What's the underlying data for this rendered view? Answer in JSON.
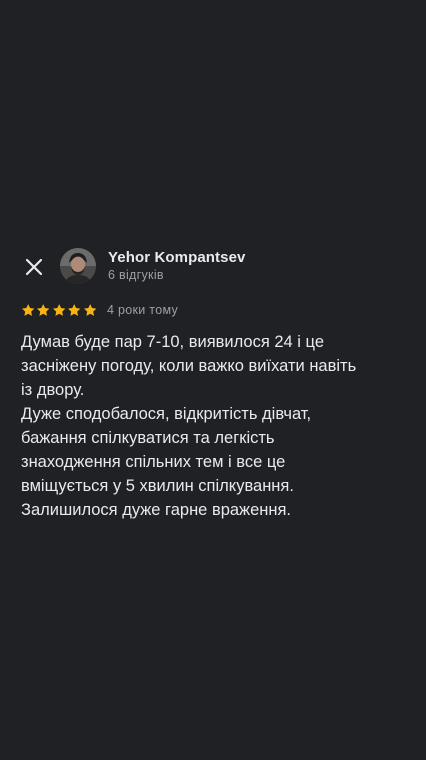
{
  "review": {
    "author_name": "Yehor Kompantsev",
    "review_count": "6 відгуків",
    "rating": 5,
    "max_rating": 5,
    "date": "4 роки тому",
    "text": "Думав буде пар 7-10, виявилося 24 і це\nзасніжену погоду, коли важко виїхати навіть\nіз двору.\nДуже сподобалося, відкритість дівчат,\nбажання спілкуватися та легкість\nзнаходження спільних тем і все це\nвміщується у 5 хвилин спілкування.\nЗалишилося дуже гарне враження."
  },
  "icons": {
    "close": "close-icon",
    "star": "star-icon",
    "avatar": "avatar"
  },
  "colors": {
    "background": "#202124",
    "text": "#e8eaed",
    "secondary_text": "#9aa0a6",
    "star": "#f7b413"
  }
}
